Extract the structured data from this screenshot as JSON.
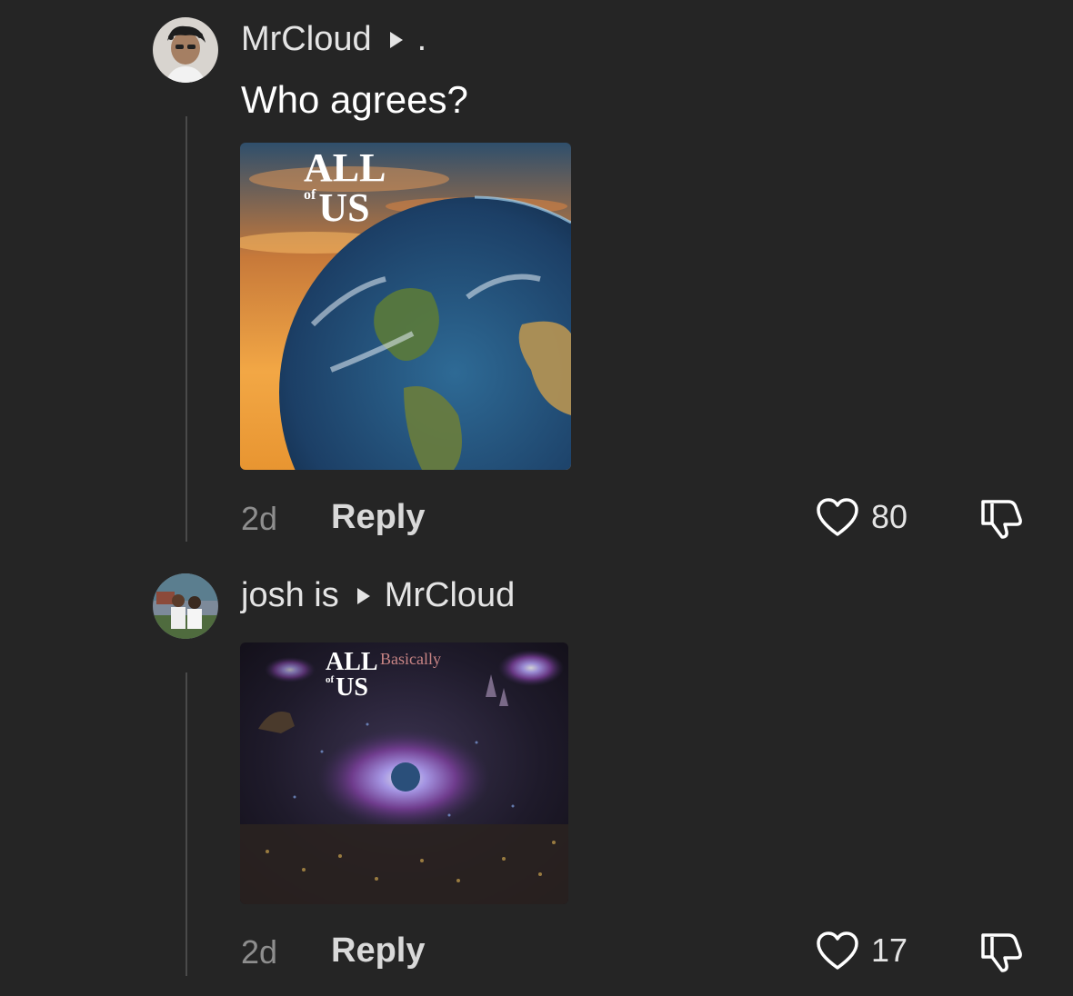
{
  "comments": [
    {
      "author": "MrCloud",
      "reply_to": ".",
      "text": "Who agrees?",
      "attachment": {
        "title_top": "ALL",
        "title_of": "of",
        "title_bottom": "US"
      },
      "time": "2d",
      "reply_label": "Reply",
      "likes": "80"
    },
    {
      "author": "josh is",
      "reply_to": "MrCloud",
      "attachment": {
        "title_top": "ALL",
        "title_of": "of",
        "title_bottom": "US",
        "heading": "Basically"
      },
      "time": "2d",
      "reply_label": "Reply",
      "likes": "17"
    }
  ],
  "icons": {
    "like": "heart-outline-icon",
    "dislike": "thumbs-down-outline-icon"
  },
  "colors": {
    "background": "#252525",
    "thread_line": "#4a4a4a",
    "meta_text": "#8e8e8e"
  }
}
